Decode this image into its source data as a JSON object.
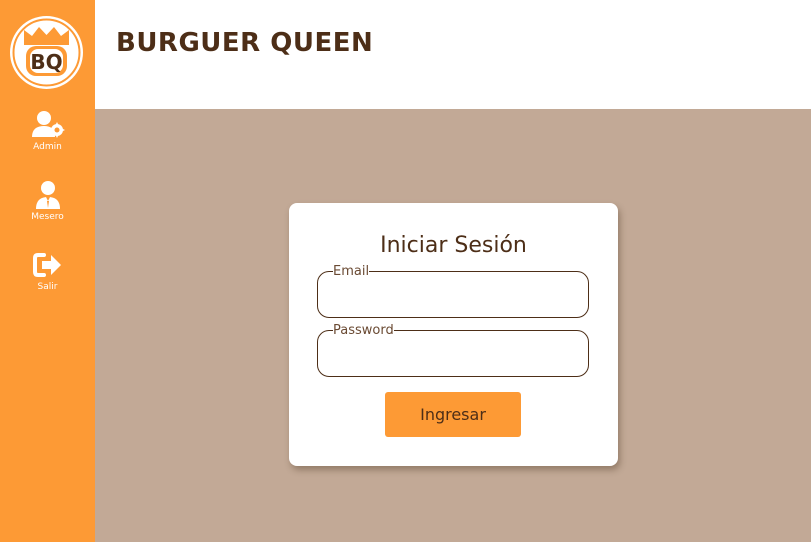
{
  "app": {
    "logo_text": "BQ",
    "title": "BURGUER QUEEN"
  },
  "sidebar": {
    "items": [
      {
        "label": "Admin",
        "icon": "user-cog-icon"
      },
      {
        "label": "Mesero",
        "icon": "waiter-icon"
      },
      {
        "label": "Salir",
        "icon": "sign-out-icon"
      }
    ]
  },
  "login": {
    "title": "Iniciar Sesión",
    "email_label": "Email",
    "email_value": "",
    "password_label": "Password",
    "password_value": "",
    "submit_label": "Ingresar"
  },
  "colors": {
    "sidebar": "#fd9a35",
    "header_bg": "#ffffff",
    "content_bg": "#c2a996",
    "brand_text": "#4d2e17",
    "button": "#fd9a35"
  }
}
